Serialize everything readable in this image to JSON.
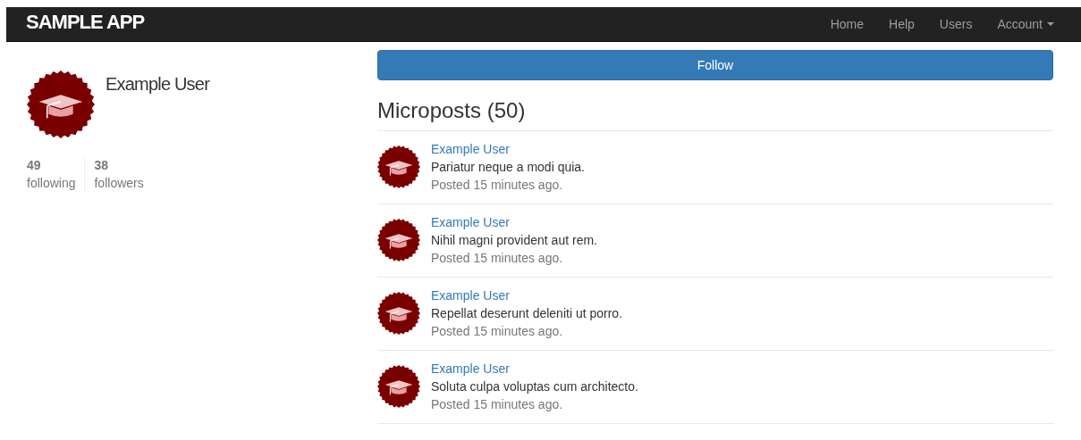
{
  "navbar": {
    "brand": "SAMPLE APP",
    "links": [
      {
        "label": "Home",
        "dropdown": false
      },
      {
        "label": "Help",
        "dropdown": false
      },
      {
        "label": "Users",
        "dropdown": false
      },
      {
        "label": "Account",
        "dropdown": true
      }
    ]
  },
  "profile": {
    "name": "Example User",
    "stats": [
      {
        "count": "49",
        "label": "following"
      },
      {
        "count": "38",
        "label": "followers"
      }
    ]
  },
  "follow_button": "Follow",
  "microposts": {
    "heading": "Microposts (50)",
    "items": [
      {
        "user": "Example User",
        "content": "Pariatur neque a modi quia.",
        "timestamp": "Posted 15 minutes ago."
      },
      {
        "user": "Example User",
        "content": "Nihil magni provident aut rem.",
        "timestamp": "Posted 15 minutes ago."
      },
      {
        "user": "Example User",
        "content": "Repellat deserunt deleniti ut porro.",
        "timestamp": "Posted 15 minutes ago."
      },
      {
        "user": "Example User",
        "content": "Soluta culpa voluptas cum architecto.",
        "timestamp": "Posted 15 minutes ago."
      }
    ]
  }
}
